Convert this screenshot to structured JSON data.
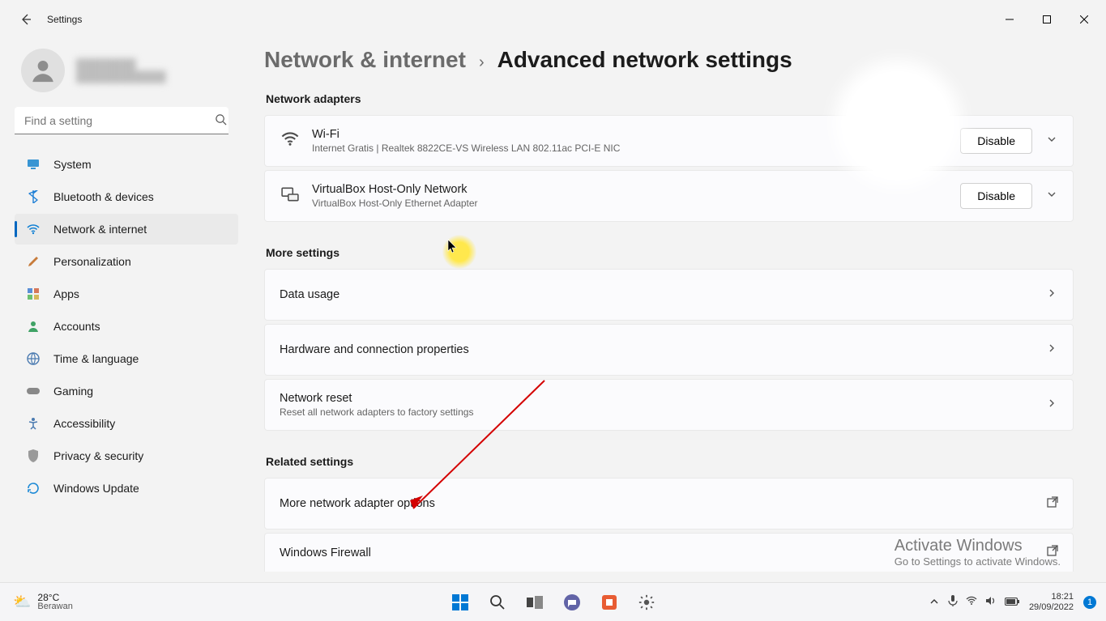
{
  "window": {
    "title": "Settings"
  },
  "search": {
    "placeholder": "Find a setting"
  },
  "nav": {
    "items": [
      {
        "label": "System",
        "icon": "system"
      },
      {
        "label": "Bluetooth & devices",
        "icon": "bluetooth"
      },
      {
        "label": "Network & internet",
        "icon": "wifi",
        "active": true
      },
      {
        "label": "Personalization",
        "icon": "brush"
      },
      {
        "label": "Apps",
        "icon": "apps"
      },
      {
        "label": "Accounts",
        "icon": "accounts"
      },
      {
        "label": "Time & language",
        "icon": "time"
      },
      {
        "label": "Gaming",
        "icon": "gaming"
      },
      {
        "label": "Accessibility",
        "icon": "accessibility"
      },
      {
        "label": "Privacy & security",
        "icon": "privacy"
      },
      {
        "label": "Windows Update",
        "icon": "update"
      }
    ]
  },
  "breadcrumb": {
    "parent": "Network & internet",
    "current": "Advanced network settings"
  },
  "sections": {
    "adapters": {
      "heading": "Network adapters",
      "items": [
        {
          "title": "Wi-Fi",
          "subtitle": "Internet Gratis | Realtek 8822CE-VS Wireless LAN 802.11ac PCI-E NIC",
          "action": "Disable"
        },
        {
          "title": "VirtualBox Host-Only Network",
          "subtitle": "VirtualBox Host-Only Ethernet Adapter",
          "action": "Disable"
        }
      ]
    },
    "more": {
      "heading": "More settings",
      "items": [
        {
          "title": "Data usage"
        },
        {
          "title": "Hardware and connection properties"
        },
        {
          "title": "Network reset",
          "subtitle": "Reset all network adapters to factory settings"
        }
      ]
    },
    "related": {
      "heading": "Related settings",
      "items": [
        {
          "title": "More network adapter options",
          "external": true
        },
        {
          "title": "Windows Firewall",
          "external": true
        }
      ]
    }
  },
  "watermark": {
    "line1": "Activate Windows",
    "line2": "Go to Settings to activate Windows."
  },
  "taskbar": {
    "weather": {
      "temp": "28°C",
      "desc": "Berawan"
    },
    "clock": {
      "time": "18:21",
      "date": "29/09/2022"
    },
    "notif_count": "1"
  },
  "colors": {
    "accent": "#0067c0"
  }
}
